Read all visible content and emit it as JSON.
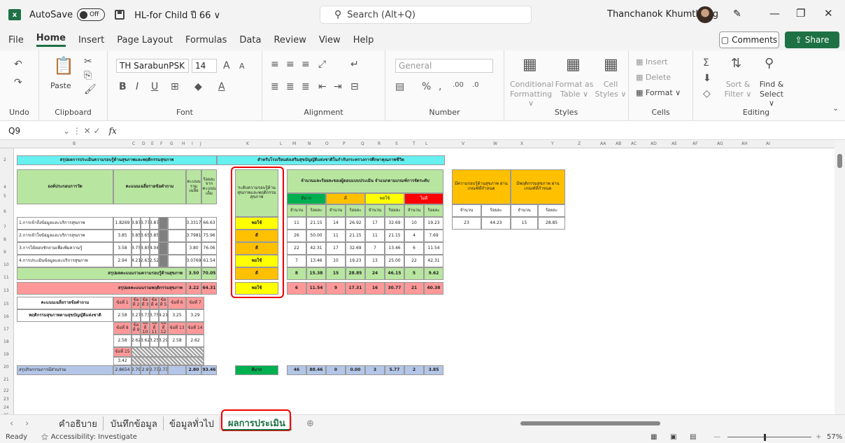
{
  "titlebar": {
    "app_icon": "excel-logo",
    "app_icon_text": "x",
    "autosave_label": "AutoSave",
    "autosave_state": "Off",
    "filename": "HL-for Child ปี 66 ∨",
    "search_placeholder": "Search (Alt+Q)",
    "user_name": "Thanchanok Khumthong"
  },
  "menu": {
    "tabs": [
      "File",
      "Home",
      "Insert",
      "Page Layout",
      "Formulas",
      "Data",
      "Review",
      "View",
      "Help"
    ],
    "active": "Home",
    "comments": "Comments",
    "share": "Share"
  },
  "ribbon": {
    "undo": "Undo",
    "clipboard": "Clipboard",
    "paste": "Paste",
    "font_label": "Font",
    "font_name": "TH SarabunPSK",
    "font_size": "14",
    "alignment": "Alignment",
    "number_label": "Number",
    "number_format": "General",
    "conditional": "Conditional",
    "formatting": "Formatting ∨",
    "format_as": "Format as",
    "table": "Table ∨",
    "cell": "Cell",
    "styles_dd": "Styles ∨",
    "styles": "Styles",
    "insert": "Insert",
    "delete": "Delete",
    "format": "Format ∨",
    "cells": "Cells",
    "sort_filter": "Sort &",
    "filter": "Filter ∨",
    "find_select": "Find &",
    "select": "Select ∨",
    "editing": "Editing"
  },
  "formula_bar": {
    "name_box": "Q9",
    "fx": "fx",
    "value": ""
  },
  "sheet": {
    "columns": [
      "B",
      "C",
      "D",
      "E",
      "F",
      "G",
      "H",
      "I",
      "J",
      "K",
      "L",
      "M",
      "N",
      "O",
      "P",
      "Q",
      "R",
      "S",
      "T",
      "L",
      "V",
      "W",
      "X",
      "Y",
      "Z",
      "AA",
      "AB",
      "AC",
      "AD",
      "AE",
      "AF",
      "AG",
      "AH",
      "AI"
    ],
    "rows": [
      "2",
      "4",
      "5",
      "6",
      "7",
      "8",
      "9",
      "10",
      "11",
      "13",
      "15",
      "16",
      "17",
      "18",
      "19",
      "20",
      "21",
      "22",
      "23",
      "24",
      "25"
    ],
    "title_left": "สรุปผลการประเมินความรอบรู้ด้านสุขภาพและพฤติกรรมสุขภาพ",
    "title_right": "สำหรับโรงเรียนส่งเสริมสุขบัญญัติแห่งชาติในกำกับกระทรวงการศึกษาคุณภาพชีวิต",
    "hdr_component": "องค์ประกอบการวัด",
    "hdr_avg": "คะแนนเฉลี่ยรายข้อคำถาม",
    "hdr_total": "คะแนนรวมเฉลี่ย",
    "hdr_pct": "ร้อยละจากคะแนนเต็ม",
    "hdr_level": "ระดับความรอบรู้ด้านสุขภาพและพฤติกรรมสุขภาพ",
    "hdr_count": "จำนวนและร้อยละของผู้ตอบแบบประเมิน จำแนกตามเกณฑ์การจัดระดับ",
    "lvl_headers": [
      "ดีมาก",
      "ดี",
      "พอใช้",
      "ไม่ดี"
    ],
    "sub_count": "จำนวน",
    "sub_pct": "ร้อยละ",
    "hdr_pass_hl": "มีความรอบรู้ด้านสุขภาพ ผ่านเกณฑ์ที่กำหนด",
    "hdr_pass_hb": "มีพฤติกรรมสุขภาพ ผ่านเกณฑ์ที่กำหนด",
    "rows_data": [
      {
        "name": "1.การเข้าถึงข้อมูลและบริการสุขภาพ",
        "a": "1.8269",
        "b": "3.87",
        "c": "3.77",
        "d": "3.87",
        "total": "3.3317",
        "pct": "66.63",
        "level": "พอใช้",
        "v": [
          "11",
          "21.15",
          "14",
          "26.92",
          "17",
          "32.69",
          "10",
          "19.23"
        ]
      },
      {
        "name": "2.การเข้าใจข้อมูลและบริการสุขภาพ",
        "a": "3.85",
        "b": "3.85",
        "c": "3.65",
        "d": "3.85",
        "total": "3.7981",
        "pct": "75.96",
        "level": "ดี",
        "v": [
          "26",
          "50.00",
          "11",
          "21.15",
          "11",
          "21.15",
          "4",
          "7.69"
        ]
      },
      {
        "name": "3.การโต้ตอบซักถามเพื่อเพิ่มความรู้",
        "a": "3.58",
        "b": "3.75",
        "c": "3.85",
        "d": "4.04",
        "total": "3.80",
        "pct": "76.06",
        "level": "ดี",
        "v": [
          "22",
          "42.31",
          "17",
          "32.69",
          "7",
          "13.46",
          "6",
          "11.54"
        ]
      },
      {
        "name": "4.การประเมินข้อมูลและบริการสุขภาพ",
        "a": "2.94",
        "b": "4.21",
        "c": "2.63",
        "d": "2.52",
        "total": "3.0769",
        "pct": "61.54",
        "level": "พอใช้",
        "v": [
          "7",
          "13.46",
          "10",
          "19.23",
          "13",
          "25.00",
          "22",
          "42.31"
        ]
      }
    ],
    "pass_hl": {
      "count_label": "จำนวน",
      "pct_label": "ร้อยละ",
      "count": "23",
      "pct": "44.23"
    },
    "pass_hb": {
      "count_label": "จำนวน",
      "pct_label": "ร้อยละ",
      "count": "15",
      "pct": "28.85"
    },
    "summary_hl": {
      "label": "สรุปผลคะแนนรวมความรอบรู้ด้านสุขภาพ",
      "total": "3.50",
      "pct": "70.05",
      "level": "ดี",
      "v": [
        "8",
        "15.38",
        "15",
        "28.85",
        "24",
        "46.15",
        "5",
        "9.62"
      ]
    },
    "summary_hb": {
      "label": "สรุปผลคะแนนรวมพฤติกรรมสุขภาพ",
      "total": "3.22",
      "pct": "64.31",
      "level": "พอใช้",
      "v": [
        "6",
        "11.54",
        "9",
        "17.31",
        "16",
        "30.77",
        "21",
        "40.38"
      ]
    },
    "behavior_title": "คะแนนเฉลี่ยรายข้อคำถาม",
    "behavior_label": "พฤติกรรมสุขภาพตามสุขบัญญัติแห่งชาติ",
    "q_row1": [
      "ข้อที่ 1",
      "ข้อที่ 2",
      "ข้อที่ 3",
      "ข้อที่ 4",
      "ข้อที่ 5",
      "ข้อที่ 6",
      "ข้อที่ 7"
    ],
    "v_row1": [
      "2.58",
      "3.27",
      "3.73",
      "3.75",
      "4.21",
      "3.25",
      "3.29"
    ],
    "q_row2": [
      "ข้อที่ 8",
      "ข้อที่ 9",
      "ข้อที่ 10",
      "ข้อที่ 11",
      "ข้อที่ 12",
      "ข้อที่ 13",
      "ข้อที่ 14"
    ],
    "v_row2": [
      "2.58",
      "2.62",
      "3.62",
      "3.25",
      "3.29",
      "2.58",
      "2.62"
    ],
    "q15": "ข้อที่ 15",
    "v15": "3.42",
    "summary_all": {
      "label": "สรุปกิจกรรมการมีส่วนร่วม",
      "a": "2.8654",
      "b": "2.79",
      "c": "2.9",
      "d": "2.73",
      "e": "2.73",
      "total": "2.80",
      "pct": "93.46",
      "level": "ดีมาก",
      "v": [
        "46",
        "88.46",
        "0",
        "0.00",
        "3",
        "5.77",
        "2",
        "3.85"
      ]
    }
  },
  "sheet_tabs": [
    "คำอธิบาย",
    "บันทึกข้อมูล",
    "ข้อมูลทั่วไป",
    "ผลการประเมิน"
  ],
  "active_sheet": "ผลการประเมิน",
  "status": {
    "ready": "Ready",
    "accessibility": "Accessibility: Investigate",
    "zoom": "57%"
  },
  "colors": {
    "excel_green": "#1e7145",
    "highlight_red": "#e00000"
  }
}
